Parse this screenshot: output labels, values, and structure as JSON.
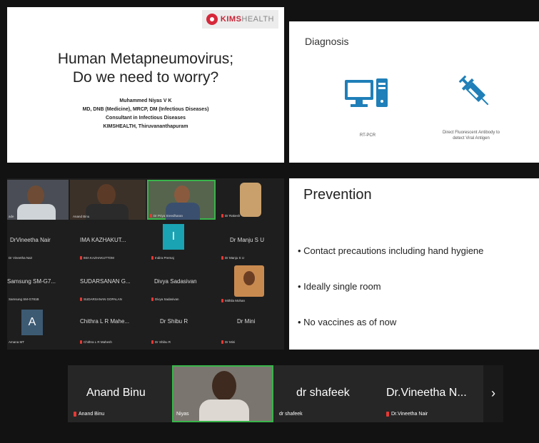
{
  "slide_title": {
    "logo_bold": "KIMS",
    "logo_light": "HEALTH",
    "title_line1": "Human Metapneumovirus;",
    "title_line2": "Do we need to worry?",
    "author": "Muhammed Niyas V K",
    "qualifications": "MD, DNB (Medicine), MRCP, DM (Infectious Diseases)",
    "role": "Consultant in Infectious Diseases",
    "institution": "KIMSHEALTH, Thiruvananthapuram"
  },
  "slide_diagnosis": {
    "title": "Diagnosis",
    "item1_label": "RT-PCR",
    "item2_label_line1": "Direct Fluorescent Antibody to",
    "item2_label_line2": "detect Viral Antigen",
    "icon_color": "#1f7fb8"
  },
  "slide_prevention": {
    "title": "Prevention",
    "bullets": [
      "• Contact precautions including hand hygiene",
      "• Ideally single room",
      "• No vaccines as of now"
    ]
  },
  "gallery": {
    "tiles": [
      {
        "name": "",
        "sub": "ade"
      },
      {
        "name": "",
        "sub": "Anand Binu"
      },
      {
        "name": "",
        "sub": "Dr Priya Sreedharan"
      },
      {
        "name": "",
        "sub": "Dr Rakesh"
      },
      {
        "name": "DrVineetha Nair",
        "sub": "Dr Vineetha Nair"
      },
      {
        "name": "IMA KAZHAKUT...",
        "sub": "IMA KAZHAKUTTOM"
      },
      {
        "name": "",
        "sub": "Indira Premaj",
        "avatar": "I"
      },
      {
        "name": "Dr  Manju S U",
        "sub": "Dr  Manju S U"
      },
      {
        "name": "Samsung SM-G7...",
        "sub": "Samsung SM-G781B"
      },
      {
        "name": "SUDARSANAN G...",
        "sub": "SUDARSANAN GOPALAN"
      },
      {
        "name": "Divya Sadasivan",
        "sub": "Divya Sadasivan"
      },
      {
        "name": "",
        "sub": "Mithila Mohan"
      },
      {
        "name": "",
        "sub": "Amana MT",
        "avatar": "A"
      },
      {
        "name": "Chithra L R Mahe...",
        "sub": "Chithra L R Mahesh"
      },
      {
        "name": "Dr Shibu R",
        "sub": "Dr Shibu R"
      },
      {
        "name": "Dr Mini",
        "sub": "Dr Mini"
      }
    ]
  },
  "strip": {
    "tiles": [
      {
        "name": "Anand Binu",
        "sub": "Anand Binu"
      },
      {
        "name": "",
        "sub": "Niyas"
      },
      {
        "name": "dr shafeek",
        "sub": "dr shafeek"
      },
      {
        "name": "Dr.Vineetha N...",
        "sub": "Dr.Vineetha Nair"
      }
    ],
    "next_label": "›",
    "active_border": "#39b54a"
  },
  "colors": {
    "mic_muted": "#e53935",
    "avatar_i": "#1aa3b3",
    "avatar_a": "#3d5a73"
  }
}
